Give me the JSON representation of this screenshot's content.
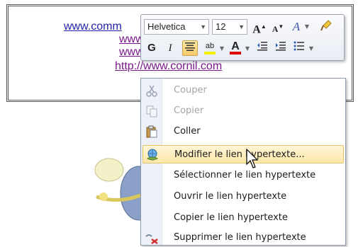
{
  "document": {
    "links": [
      {
        "text": "www.comm",
        "style": "blue"
      },
      {
        "text": "www",
        "style": "purple"
      },
      {
        "text": "www",
        "style": "purple"
      },
      {
        "text": "http://www.cornil.com",
        "style": "purple"
      }
    ]
  },
  "mini_toolbar": {
    "font_name": "Helvetica",
    "font_size": "12",
    "grow_font": "A",
    "shrink_font": "A",
    "styles": "A",
    "bold": "G",
    "italic": "I",
    "font_color": "A",
    "highlight": "ab"
  },
  "context_menu": {
    "items": [
      {
        "label": "Couper",
        "icon": "scissors-icon",
        "enabled": false
      },
      {
        "label": "Copier",
        "icon": "copy-icon",
        "enabled": false
      },
      {
        "label": "Coller",
        "icon": "paste-icon",
        "enabled": true
      },
      {
        "label": "Modifier le lien hypertexte...",
        "icon": "edit-hyperlink-icon",
        "enabled": true,
        "highlighted": true
      },
      {
        "label": "Sélectionner le lien hypertexte",
        "icon": "",
        "enabled": true
      },
      {
        "label": "Ouvrir le lien hypertexte",
        "icon": "",
        "enabled": true
      },
      {
        "label": "Copier le lien hypertexte",
        "icon": "",
        "enabled": true
      },
      {
        "label": "Supprimer le lien hypertexte",
        "icon": "remove-hyperlink-icon",
        "enabled": true
      }
    ]
  },
  "colors": {
    "link_blue": "#2222aa",
    "link_visited": "#7a1a8a",
    "menu_hover": "#fde7a8",
    "font_color_bar": "#e00000"
  }
}
